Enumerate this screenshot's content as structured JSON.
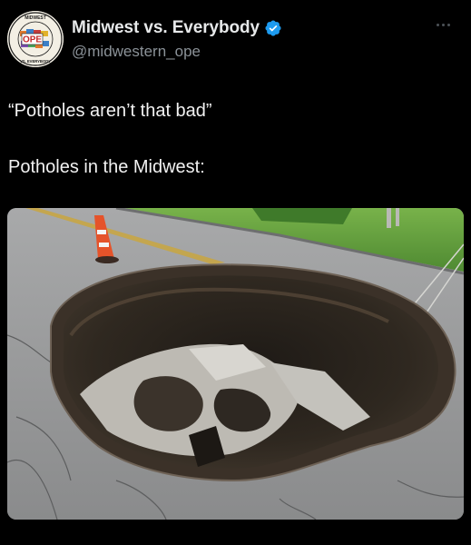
{
  "author": {
    "display_name": "Midwest vs. Everybody",
    "handle": "@midwestern_ope",
    "verified": true,
    "avatar_text": "OPE",
    "avatar_ring_top": "MIDWEST",
    "avatar_ring_bottom": "VS. EVERYBODY"
  },
  "post": {
    "line1": "“Potholes aren’t that bad”",
    "line2": "Potholes in the Midwest:"
  },
  "media": {
    "description_icon": "photo-icon",
    "colors": {
      "road": "#8e8f90",
      "grass": "#5f9a3b",
      "cone": "#e5532a",
      "hole_dark": "#2a241e"
    }
  },
  "colors": {
    "background": "#000000",
    "verified_badge": "#1d9bf0",
    "handle": "#8b9298"
  }
}
